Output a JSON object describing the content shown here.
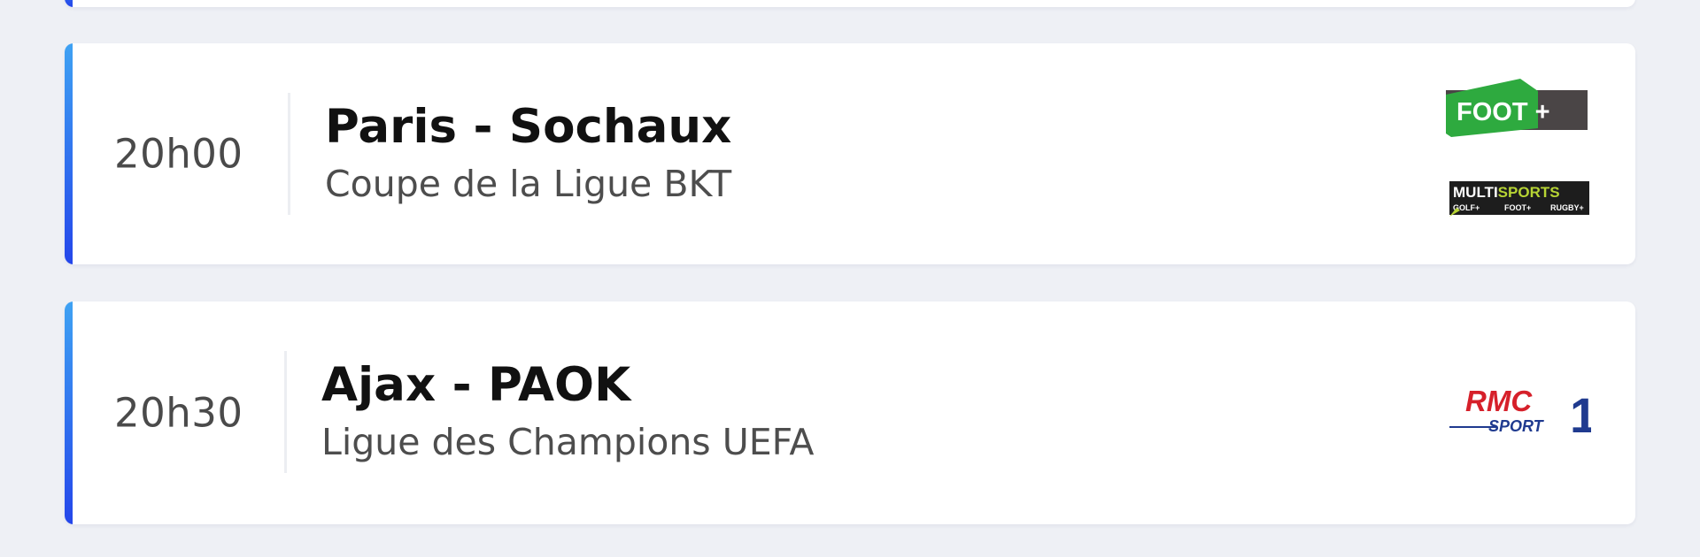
{
  "matches": [
    {
      "time": "20h00",
      "teams": "Paris - Sochaux",
      "competition": "Coupe de la Ligue BKT",
      "channels": [
        {
          "icon": "foot-plus-logo",
          "text": "FOOT +"
        },
        {
          "icon": "multisports-logo",
          "text": "MULTISPORTS",
          "sub": [
            "GOLF+",
            "FOOT+",
            "RUGBY+"
          ]
        }
      ]
    },
    {
      "time": "20h30",
      "teams": "Ajax - PAOK",
      "competition": "Ligue des Champions UEFA",
      "channels": [
        {
          "icon": "rmc-sport-1-logo",
          "text": "RMC",
          "sub_text": "SPORT",
          "number": "1"
        }
      ]
    }
  ],
  "colors": {
    "background": "#eef0f5",
    "accent_top": "#3fa2f3",
    "accent_bottom": "#2446ea",
    "foot_green": "#2eaa3f",
    "multisports_yellow": "#b7d434",
    "rmc_red": "#d6202a",
    "rmc_blue": "#1f3a8f"
  }
}
